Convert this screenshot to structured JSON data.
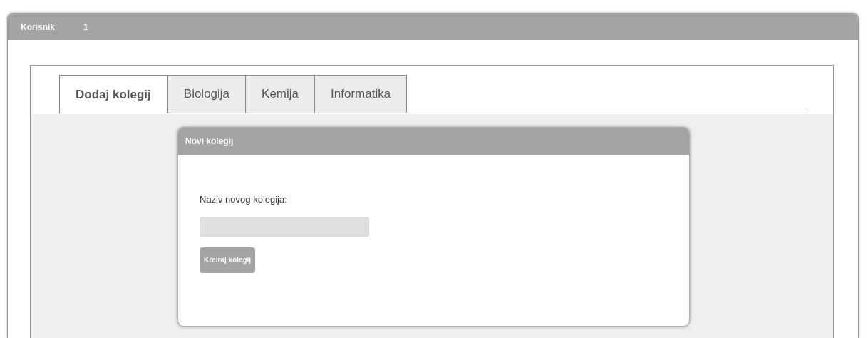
{
  "header": {
    "label": "Korisnik",
    "value": "1"
  },
  "tabs": [
    {
      "label": "Dodaj kolegij",
      "selected": true
    },
    {
      "label": "Biologija",
      "selected": false
    },
    {
      "label": "Kemija",
      "selected": false
    },
    {
      "label": "Informatika",
      "selected": false
    }
  ],
  "dialog": {
    "title": "Novi kolegij",
    "field_label": "Naziv novog kolegija:",
    "button": "Kreiraj kolegij"
  }
}
